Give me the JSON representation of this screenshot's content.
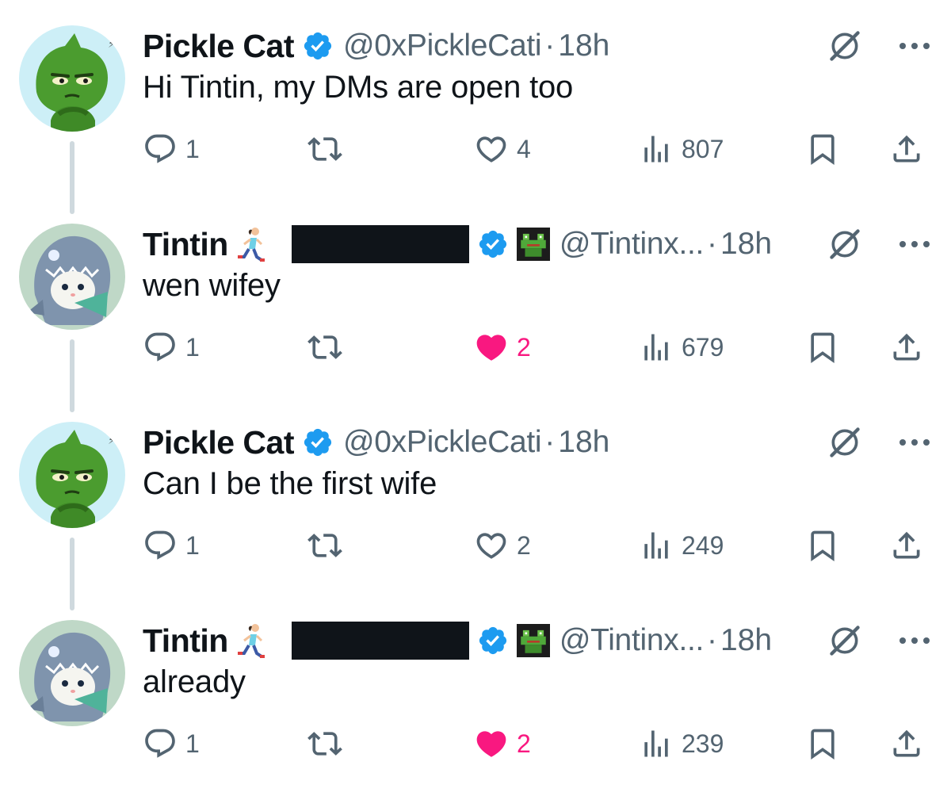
{
  "colors": {
    "accent": "#1d9bf0",
    "muted": "#536471",
    "like": "#f91880",
    "text": "#0f1419"
  },
  "tweets": [
    {
      "name": "Pickle Cat",
      "handle": "@0xPickleCati",
      "dot": "·",
      "time": "18h",
      "text": "Hi Tintin, my DMs are open too",
      "replies": "1",
      "likes": "4",
      "liked": false,
      "views": "807",
      "avatar": "pickle-cat-avatar"
    },
    {
      "name": "Tintin",
      "handle": "@Tintinx...",
      "dot": "·",
      "time": "18h",
      "text": "wen wifey",
      "replies": "1",
      "likes": "2",
      "liked": true,
      "views": "679",
      "avatar": "shark-cat-avatar"
    },
    {
      "name": "Pickle Cat",
      "handle": "@0xPickleCati",
      "dot": "·",
      "time": "18h",
      "text": "Can I be the first wife",
      "replies": "1",
      "likes": "2",
      "liked": false,
      "views": "249",
      "avatar": "pickle-cat-avatar"
    },
    {
      "name": "Tintin",
      "handle": "@Tintinx...",
      "dot": "·",
      "time": "18h",
      "text": "already",
      "replies": "1",
      "likes": "2",
      "liked": true,
      "views": "239",
      "avatar": "shark-cat-avatar"
    }
  ],
  "icons": {
    "reply": "reply-icon",
    "retweet": "retweet-icon",
    "like": "heart-icon",
    "views": "views-icon",
    "bookmark": "bookmark-icon",
    "share": "share-icon",
    "grok": "grok-icon",
    "more": "more-icon",
    "verified": "verified-badge-icon"
  }
}
